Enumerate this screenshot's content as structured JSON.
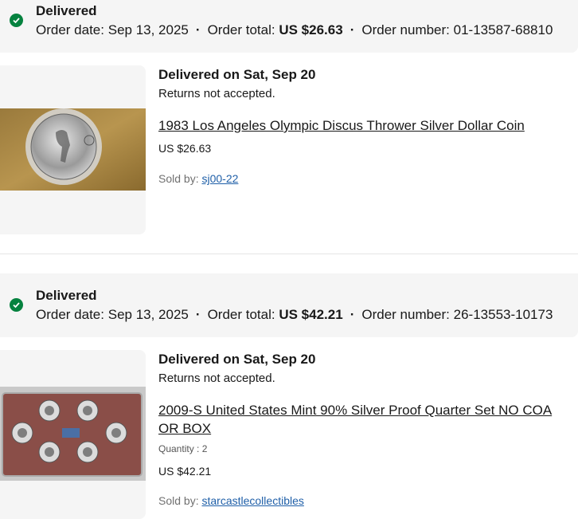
{
  "orders": [
    {
      "status": "Delivered",
      "order_date_label": "Order date:",
      "order_date": "Sep 13, 2025",
      "order_total_label": "Order total:",
      "order_total": "US $26.63",
      "order_number_label": "Order number:",
      "order_number": "01-13587-68810",
      "delivery": "Delivered on Sat, Sep 20",
      "returns": "Returns not accepted.",
      "item_title": "1983 Los Angeles Olympic Discus Thrower Silver Dollar Coin",
      "price": "US $26.63",
      "sold_by_label": "Sold by:",
      "seller": "sj00-22"
    },
    {
      "status": "Delivered",
      "order_date_label": "Order date:",
      "order_date": "Sep 13, 2025",
      "order_total_label": "Order total:",
      "order_total": "US $42.21",
      "order_number_label": "Order number:",
      "order_number": "26-13553-10173",
      "delivery": "Delivered on Sat, Sep 20",
      "returns": "Returns not accepted.",
      "item_title": "2009-S United States Mint 90% Silver Proof Quarter Set NO COA OR BOX",
      "quantity": "Quantity : 2",
      "price": "US $42.21",
      "sold_by_label": "Sold by:",
      "seller": "starcastlecollectibles"
    }
  ],
  "colors": {
    "status_green": "#05823f",
    "header_bg": "#f5f5f5",
    "link_blue": "#1f5fa8"
  }
}
